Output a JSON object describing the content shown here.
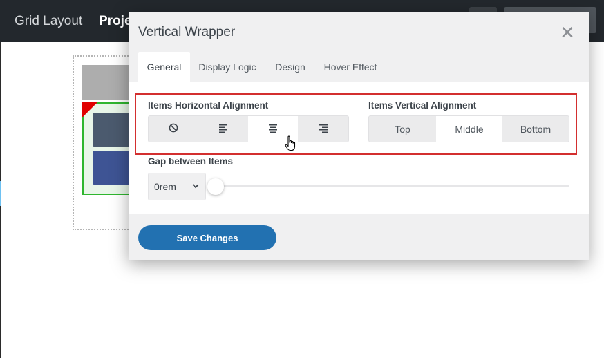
{
  "app": {
    "topbar_title": "Grid Layout",
    "topbar_title2": "Proje"
  },
  "modal": {
    "title": "Vertical Wrapper",
    "close_icon": "close-icon"
  },
  "tabs": [
    {
      "label": "General",
      "active": true
    },
    {
      "label": "Display Logic",
      "active": false
    },
    {
      "label": "Design",
      "active": false
    },
    {
      "label": "Hover Effect",
      "active": false
    }
  ],
  "horizontal_alignment": {
    "label": "Items Horizontal Alignment",
    "options": [
      {
        "icon": "none-icon",
        "active": false
      },
      {
        "icon": "align-left-icon",
        "active": false
      },
      {
        "icon": "align-center-icon",
        "active": true
      },
      {
        "icon": "align-right-icon",
        "active": false
      }
    ]
  },
  "vertical_alignment": {
    "label": "Items Vertical Alignment",
    "options": [
      {
        "label": "Top",
        "active": false
      },
      {
        "label": "Middle",
        "active": true
      },
      {
        "label": "Bottom",
        "active": false
      }
    ]
  },
  "gap": {
    "label": "Gap between Items",
    "value": "0rem",
    "slider_fraction": 0
  },
  "footer": {
    "save_label": "Save Changes"
  },
  "colors": {
    "accent": "#2271b1",
    "highlight_border": "#d32f2f"
  }
}
